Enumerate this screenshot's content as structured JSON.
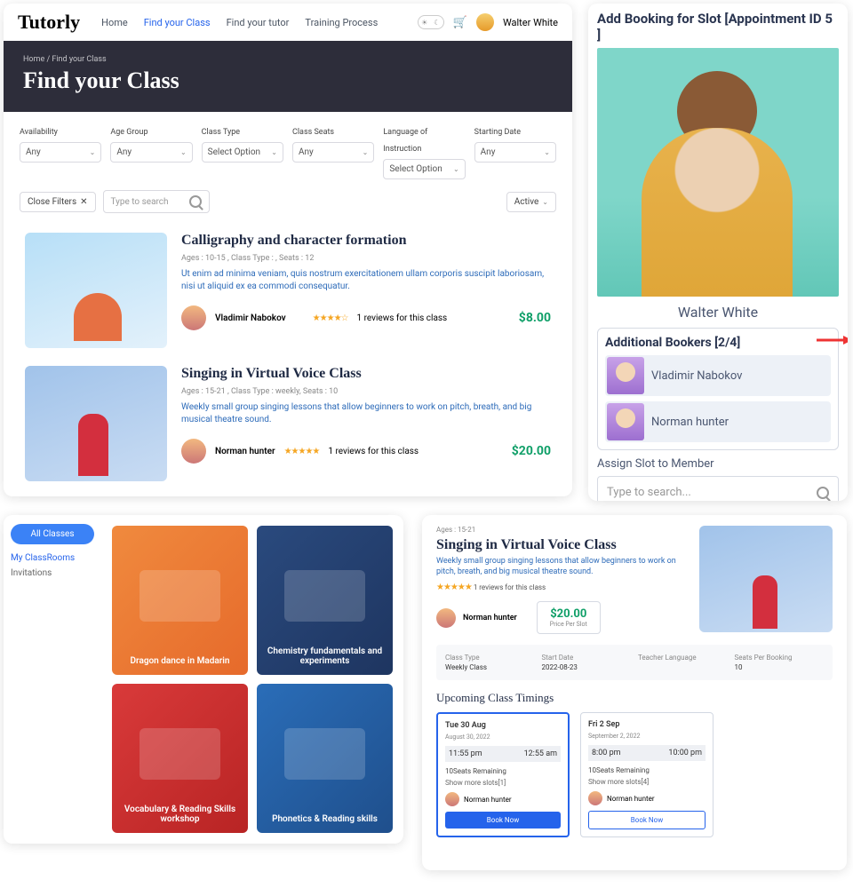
{
  "panelA": {
    "brand": "Tutorly",
    "nav": [
      "Home",
      "Find your Class",
      "Find your tutor",
      "Training Process"
    ],
    "user": "Walter White",
    "breadcrumb": "Home / Find your Class",
    "title": "Find your Class",
    "filters": [
      {
        "label": "Availability",
        "value": "Any"
      },
      {
        "label": "Age Group",
        "value": "Any"
      },
      {
        "label": "Class Type",
        "value": "Select Option"
      },
      {
        "label": "Class Seats",
        "value": "Any"
      },
      {
        "label": "Language of Instruction",
        "value": "Select Option"
      },
      {
        "label": "Starting Date",
        "value": "Any"
      }
    ],
    "closeFilters": "Close Filters",
    "searchPlaceholder": "Type to search",
    "status": "Active",
    "classes": [
      {
        "title": "Calligraphy and character formation",
        "meta": "Ages : 10-15 , Class Type : , Seats : 12",
        "desc": "Ut enim ad minima veniam, quis nostrum exercitationem ullam corporis suscipit laboriosam, nisi ut aliquid ex ea commodi consequatur.",
        "tutor": "Vladimir Nabokov",
        "stars": "★★★★☆",
        "reviews": "1 reviews for this class",
        "price": "$8.00"
      },
      {
        "title": "Singing in Virtual Voice Class",
        "meta": "Ages : 15-21 , Class Type : weekly, Seats : 10",
        "desc": "Weekly small group singing lessons that allow beginners to work on pitch, breath, and big musical theatre sound.",
        "tutor": "Norman hunter",
        "stars": "★★★★★",
        "reviews": "1 reviews for this class",
        "price": "$20.00"
      }
    ]
  },
  "panelB": {
    "title": "Add Booking for Slot [Appointment ID 5 ]",
    "name": "Walter White",
    "bookersTitle": "Additional Bookers [2/4]",
    "bookers": [
      "Vladimir Nabokov",
      "Norman hunter"
    ],
    "assign": "Assign Slot to Member",
    "searchPlaceholder": "Type to search..."
  },
  "panelC": {
    "all": "All Classes",
    "links": [
      "My ClassRooms",
      "Invitations"
    ],
    "cards": [
      "Dragon dance in Madarin",
      "Chemistry fundamentals and experiments",
      "Vocabulary &amp; Reading Skills workshop",
      "Phonetics &amp; Reading skills"
    ]
  },
  "panelD": {
    "ages": "Ages : 15-21",
    "title": "Singing in Virtual Voice Class",
    "desc": "Weekly small group singing lessons that allow beginners to work on pitch, breath, and big musical theatre sound.",
    "stars": "★★★★★",
    "reviews": "1 reviews for this class",
    "tutor": "Norman hunter",
    "price": "$20.00",
    "priceLabel": "Price Per Slot",
    "info": [
      {
        "label": "Class Type",
        "value": "Weekly Class"
      },
      {
        "label": "Start Date",
        "value": "2022-08-23"
      },
      {
        "label": "Teacher Language",
        "value": ""
      },
      {
        "label": "Seats Per Booking",
        "value": "10"
      }
    ],
    "upcoming": "Upcoming Class Timings",
    "slots": [
      {
        "day": "Tue 30 Aug",
        "date": "August 30, 2022",
        "t1": "11:55 pm",
        "t2": "12:55 am",
        "remain": "10Seats Remaining",
        "more": "Show more slots[1]",
        "tutor": "Norman hunter",
        "btn": "Book Now",
        "active": true
      },
      {
        "day": "Fri 2 Sep",
        "date": "September 2, 2022",
        "t1": "8:00 pm",
        "t2": "10:00 pm",
        "remain": "10Seats Remaining",
        "more": "Show more slots[4]",
        "tutor": "Norman hunter",
        "btn": "Book Now",
        "active": false
      }
    ]
  }
}
